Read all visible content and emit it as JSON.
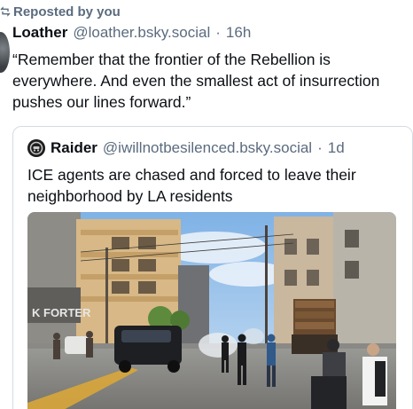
{
  "repost": {
    "label": "Reposted by you",
    "icon": "repost-icon"
  },
  "post": {
    "author_name": "Loather",
    "author_handle": "@loather.bsky.social",
    "separator": "·",
    "time": "16h",
    "text": "“Remember that the frontier of the Rebellion is everywhere. And even the smallest act of insurrection pushes our lines forward.”"
  },
  "quote": {
    "author_name": "Raider",
    "author_handle": "@iwillnotbesilenced.bsky.social",
    "separator": "·",
    "time": "1d",
    "text": "ICE agents are chased and forced to leave their neighborhood by LA residents",
    "media_kind": "street-scene-video-thumbnail"
  },
  "colors": {
    "text": "#0b0f14",
    "muted": "#5b6b7e",
    "border": "#d4dbe2"
  }
}
